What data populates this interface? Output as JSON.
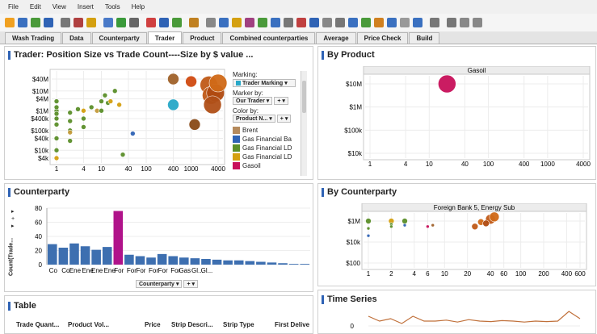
{
  "menu": [
    "File",
    "Edit",
    "View",
    "Insert",
    "Tools",
    "Help"
  ],
  "toolbar_colors": [
    "#f0a020",
    "#3a70c0",
    "#4a9a3a",
    "#2f63b5",
    "#777",
    "#b04040",
    "#d4a010",
    "#4a7ac8",
    "#3a9a3a",
    "#666",
    "#d04040",
    "#2f63b5",
    "#4a9a3a",
    "#c08020",
    "#888",
    "#3a70c0",
    "#d4a010",
    "#a04080",
    "#4a9a3a",
    "#3a70c0",
    "#777",
    "#c04040",
    "#2f63b5",
    "#888",
    "#777",
    "#3a70c0",
    "#4a9a3a",
    "#d08020",
    "#3a70c0",
    "#999",
    "#3a70c0",
    "#777",
    "#777",
    "#888",
    "#888"
  ],
  "tabs": [
    {
      "label": "Wash Trading"
    },
    {
      "label": "Data"
    },
    {
      "label": "Counterparty"
    },
    {
      "label": "Trader",
      "active": true
    },
    {
      "label": "Product"
    },
    {
      "label": "Combined counterparties"
    },
    {
      "label": "Average"
    },
    {
      "label": "Price Check"
    },
    {
      "label": "Build"
    }
  ],
  "trader": {
    "title": "Trader:  Position Size vs Trade Count----Size by $ value ...",
    "marking_label": "Marking:",
    "marking_value": "Trader Marking",
    "marker_label": "Marker by:",
    "marker_value": "Our Trader",
    "color_label": "Color by:",
    "color_value": "Product N...",
    "legend": [
      {
        "label": "Brent",
        "color": "#b58a5c"
      },
      {
        "label": "Gas  Financial Ba",
        "color": "#2f63b5"
      },
      {
        "label": "Gas  Financial LD",
        "color": "#5b8f2a"
      },
      {
        "label": "Gas  Financial LD",
        "color": "#d4a010"
      },
      {
        "label": "Gasoil",
        "color": "#c8105a"
      }
    ]
  },
  "product": {
    "title": "By Product",
    "facet": "Gasoil"
  },
  "counterparty": {
    "title": "Counterparty",
    "xlabel": "Counterparty",
    "ylabel": "Count(Trade..."
  },
  "bycp": {
    "title": "By Counterparty",
    "facet": "Foreign Bank 5, Energy Sub"
  },
  "timeseries": {
    "title": "Time Series",
    "y0": "0"
  },
  "table": {
    "title": "Table",
    "columns": [
      "Trade Quant...",
      "Product Vol...",
      "Price",
      "Strip Descri...",
      "Strip Type",
      "First Delive"
    ]
  },
  "chart_data": [
    {
      "type": "scatter",
      "title": "Trader:  Position Size vs Trade Count----Size by $ value ...",
      "xscale": "log",
      "yscale": "log",
      "xticks": [
        "1",
        "4",
        "10",
        "40",
        "100",
        "400",
        "1000",
        "4000"
      ],
      "yticks": [
        "$4k",
        "$10k",
        "$40k",
        "$100k",
        "$400k",
        "$1M",
        "$4M",
        "$10M",
        "$40M"
      ],
      "points": [
        {
          "x": 1,
          "y": 1000000,
          "c": "#5b8f2a"
        },
        {
          "x": 1,
          "y": 700000,
          "c": "#5b8f2a"
        },
        {
          "x": 1,
          "y": 1500000,
          "c": "#5b8f2a"
        },
        {
          "x": 1,
          "y": 3000000,
          "c": "#5b8f2a"
        },
        {
          "x": 1,
          "y": 400000,
          "c": "#5b8f2a"
        },
        {
          "x": 1,
          "y": 200000,
          "c": "#5b8f2a"
        },
        {
          "x": 1,
          "y": 40000,
          "c": "#5b8f2a"
        },
        {
          "x": 1,
          "y": 4000,
          "c": "#d4a010"
        },
        {
          "x": 1,
          "y": 10000,
          "c": "#5b8f2a"
        },
        {
          "x": 2,
          "y": 800000,
          "c": "#5b8f2a"
        },
        {
          "x": 2,
          "y": 300000,
          "c": "#5b8f2a"
        },
        {
          "x": 2,
          "y": 100000,
          "c": "#5b8f2a"
        },
        {
          "x": 2,
          "y": 80000,
          "c": "#c49a3a"
        },
        {
          "x": 2,
          "y": 30000,
          "c": "#5b8f2a"
        },
        {
          "x": 4,
          "y": 1000000,
          "c": "#d4a010"
        },
        {
          "x": 4,
          "y": 400000,
          "c": "#5b8f2a"
        },
        {
          "x": 4,
          "y": 150000,
          "c": "#5b8f2a"
        },
        {
          "x": 3,
          "y": 1200000,
          "c": "#5b8f2a"
        },
        {
          "x": 6,
          "y": 1500000,
          "c": "#5b8f2a"
        },
        {
          "x": 8,
          "y": 1000000,
          "c": "#c49a3a"
        },
        {
          "x": 10,
          "y": 3000000,
          "c": "#5b8f2a"
        },
        {
          "x": 10,
          "y": 1000000,
          "c": "#5b8f2a"
        },
        {
          "x": 12,
          "y": 6000000,
          "c": "#5b8f2a"
        },
        {
          "x": 14,
          "y": 2500000,
          "c": "#5b8f2a"
        },
        {
          "x": 16,
          "y": 3000000,
          "c": "#d4a010"
        },
        {
          "x": 20,
          "y": 10000000,
          "c": "#5b8f2a"
        },
        {
          "x": 25,
          "y": 2000000,
          "c": "#d4a010"
        },
        {
          "x": 30,
          "y": 6000,
          "c": "#5b8f2a"
        },
        {
          "x": 50,
          "y": 70000,
          "c": "#2f63b5"
        },
        {
          "x": 400,
          "y": 40000000,
          "c": "#a0622a"
        },
        {
          "x": 400,
          "y": 2000000,
          "c": "#28a8c8"
        },
        {
          "x": 1000,
          "y": 30000000,
          "c": "#d04a10"
        },
        {
          "x": 1200,
          "y": 200000,
          "c": "#8a4a18"
        },
        {
          "x": 2500,
          "y": 20000000,
          "c": "#c05a18"
        },
        {
          "x": 2800,
          "y": 6000000,
          "c": "#c05a18"
        },
        {
          "x": 3500,
          "y": 8000000,
          "c": "#b04a10"
        },
        {
          "x": 4000,
          "y": 25000000,
          "c": "#d06a18"
        },
        {
          "x": 3000,
          "y": 2000000,
          "c": "#b05018"
        }
      ]
    },
    {
      "type": "scatter",
      "title": "Gasoil",
      "xticks": [
        "1",
        "4",
        "10",
        "40",
        "100",
        "400",
        "1000",
        "4000"
      ],
      "yticks": [
        "$10M",
        "$1M",
        "$100k",
        "$10k"
      ],
      "points": [
        {
          "x": 20,
          "y": 10000000,
          "c": "#c8105a"
        }
      ]
    },
    {
      "type": "bar",
      "ylabel": "Count(Trade...",
      "xlabel": "Counterparty",
      "yticks": [
        "0",
        "20",
        "40",
        "60",
        "80"
      ],
      "categories": [
        "Co",
        "Co",
        "Ene",
        "Ene",
        "Ene",
        "Ene",
        "For",
        "For",
        "For",
        "For",
        "For",
        "For",
        "Gas",
        "Gl...",
        "Gl...",
        "",
        "",
        "",
        "",
        "",
        "",
        "",
        "",
        ""
      ],
      "values": [
        29,
        24,
        30,
        26,
        21,
        25,
        76,
        14,
        12,
        10,
        15,
        12,
        10,
        9,
        8,
        7,
        6,
        6,
        5,
        4,
        3,
        2,
        1,
        1
      ],
      "highlight": 6
    },
    {
      "type": "scatter",
      "title": "Foreign Bank 5, Energy Sub",
      "xticks": [
        "1",
        "2",
        "4",
        "6",
        "10",
        "20",
        "40",
        "60",
        "100",
        "200",
        "400",
        "600"
      ],
      "yticks": [
        "$1M",
        "$10k",
        "$100"
      ],
      "points": [
        {
          "x": 1,
          "y": 1000000,
          "c": "#5b8f2a"
        },
        {
          "x": 1,
          "y": 200000,
          "c": "#5b8f2a"
        },
        {
          "x": 1,
          "y": 40000,
          "c": "#2f63b5"
        },
        {
          "x": 2,
          "y": 1000000,
          "c": "#d4a010"
        },
        {
          "x": 2,
          "y": 500000,
          "c": "#5b8f2a"
        },
        {
          "x": 2,
          "y": 300000,
          "c": "#5b8f2a"
        },
        {
          "x": 3,
          "y": 1000000,
          "c": "#5b8f2a"
        },
        {
          "x": 3,
          "y": 400000,
          "c": "#2f63b5"
        },
        {
          "x": 6,
          "y": 300000,
          "c": "#c8105a"
        },
        {
          "x": 7,
          "y": 400000,
          "c": "#a0622a"
        },
        {
          "x": 25,
          "y": 300000,
          "c": "#c05a18"
        },
        {
          "x": 30,
          "y": 800000,
          "c": "#d06a18"
        },
        {
          "x": 40,
          "y": 1500000,
          "c": "#c05a18"
        },
        {
          "x": 45,
          "y": 2500000,
          "c": "#d06a18"
        },
        {
          "x": 35,
          "y": 600000,
          "c": "#b04a10"
        }
      ]
    },
    {
      "type": "line",
      "title": "Time Series",
      "yticks": [
        "0"
      ],
      "values": [
        2,
        1,
        1.5,
        0.5,
        2,
        1,
        1,
        1.2,
        0.8,
        1.3,
        1,
        0.9,
        1.1,
        1,
        0.8,
        1,
        0.9,
        1,
        3,
        1.5
      ]
    }
  ]
}
